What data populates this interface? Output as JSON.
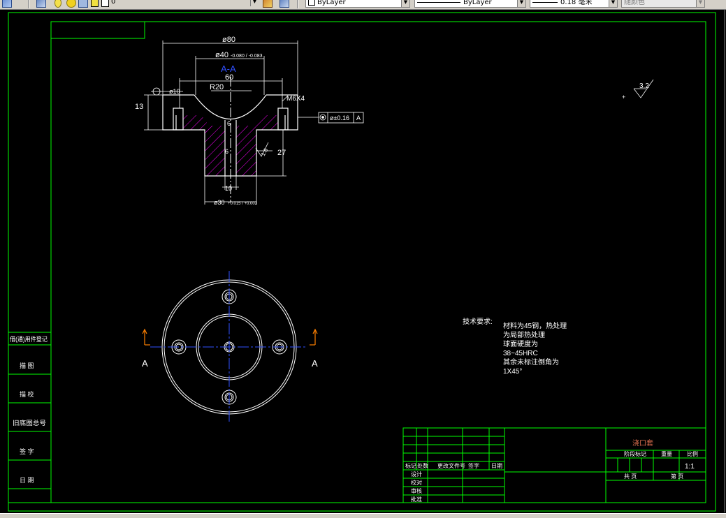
{
  "toolbar": {
    "layer_value": "0",
    "color_value": "ByLayer",
    "linetype_value": "ByLayer",
    "lineweight_value": "0.18 毫米",
    "plotstyle_value": "随颜色"
  },
  "section_view": {
    "title": "A-A",
    "dims": {
      "d80": "ø80",
      "d40": "ø40",
      "d40_tol": "-0.080 / -0.083",
      "d60": "60",
      "r20": "R20",
      "d10": "ø10",
      "h13": "13",
      "d6a": "6",
      "d6b": "6",
      "d27": "27",
      "d10b": "10",
      "d30": "ø30",
      "d30_tol": "+0.015 / +0.002",
      "thread": "M6X4",
      "datum": "A",
      "tol_value": "ø±0.16"
    },
    "roughness_local": "1.6"
  },
  "surface_roughness": "3.2",
  "top_view": {
    "label_left": "A",
    "label_right": "A"
  },
  "notes": {
    "heading": "技术要求:",
    "lines": [
      "材料为45钢，热处理",
      "为局部热处理",
      "球面硬度为",
      "38~45HRC",
      "其余未标注倒角为",
      "1X45°"
    ]
  },
  "left_strip": [
    "借(通)用件登记",
    "描  图",
    "描  校",
    "旧底图总号",
    "签  字",
    "日  期"
  ],
  "title_block": {
    "part_name": "浇口套",
    "scale": "1:1",
    "stage_label": "阶段标记",
    "weight_label": "重量",
    "scale_label": "比例",
    "sheet_total": "共  页",
    "sheet_no": "第  页",
    "rev_headers": [
      "标记",
      "处数",
      "更改文件号",
      "签字",
      "日期"
    ],
    "roles": [
      "设计",
      "校对",
      "审核",
      "批准"
    ]
  }
}
